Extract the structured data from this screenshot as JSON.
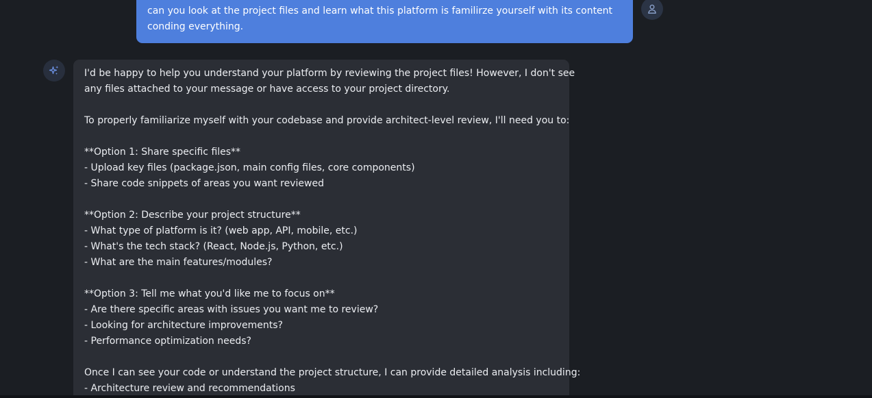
{
  "user_message": {
    "lines": [
      "can you look at the project files and learn what this platform is familirze yourself with its content",
      "conding everything."
    ],
    "avatar_icon": "user-icon",
    "bubble_color": "#4e7fdd"
  },
  "assistant_message": {
    "avatar_icon": "sparkle-icon",
    "lines": [
      "I'd be happy to help you understand your platform by reviewing the project files! However, I don't see",
      "any files attached to your message or have access to your project directory.",
      "",
      "To properly familiarize myself with your codebase and provide architect-level review, I'll need you to:",
      "",
      "**Option 1: Share specific files**",
      "- Upload key files (package.json, main config files, core components)",
      "- Share code snippets of areas you want reviewed",
      "",
      "**Option 2: Describe your project structure**",
      "- What type of platform is it? (web app, API, mobile, etc.)",
      "- What's the tech stack? (React, Node.js, Python, etc.)",
      "- What are the main features/modules?",
      "",
      "**Option 3: Tell me what you'd like me to focus on**",
      "- Are there specific areas with issues you want me to review?",
      "- Looking for architecture improvements?",
      "- Performance optimization needs?",
      "",
      "Once I can see your code or understand the project structure, I can provide detailed analysis including:",
      "- Architecture review and recommendations"
    ]
  }
}
